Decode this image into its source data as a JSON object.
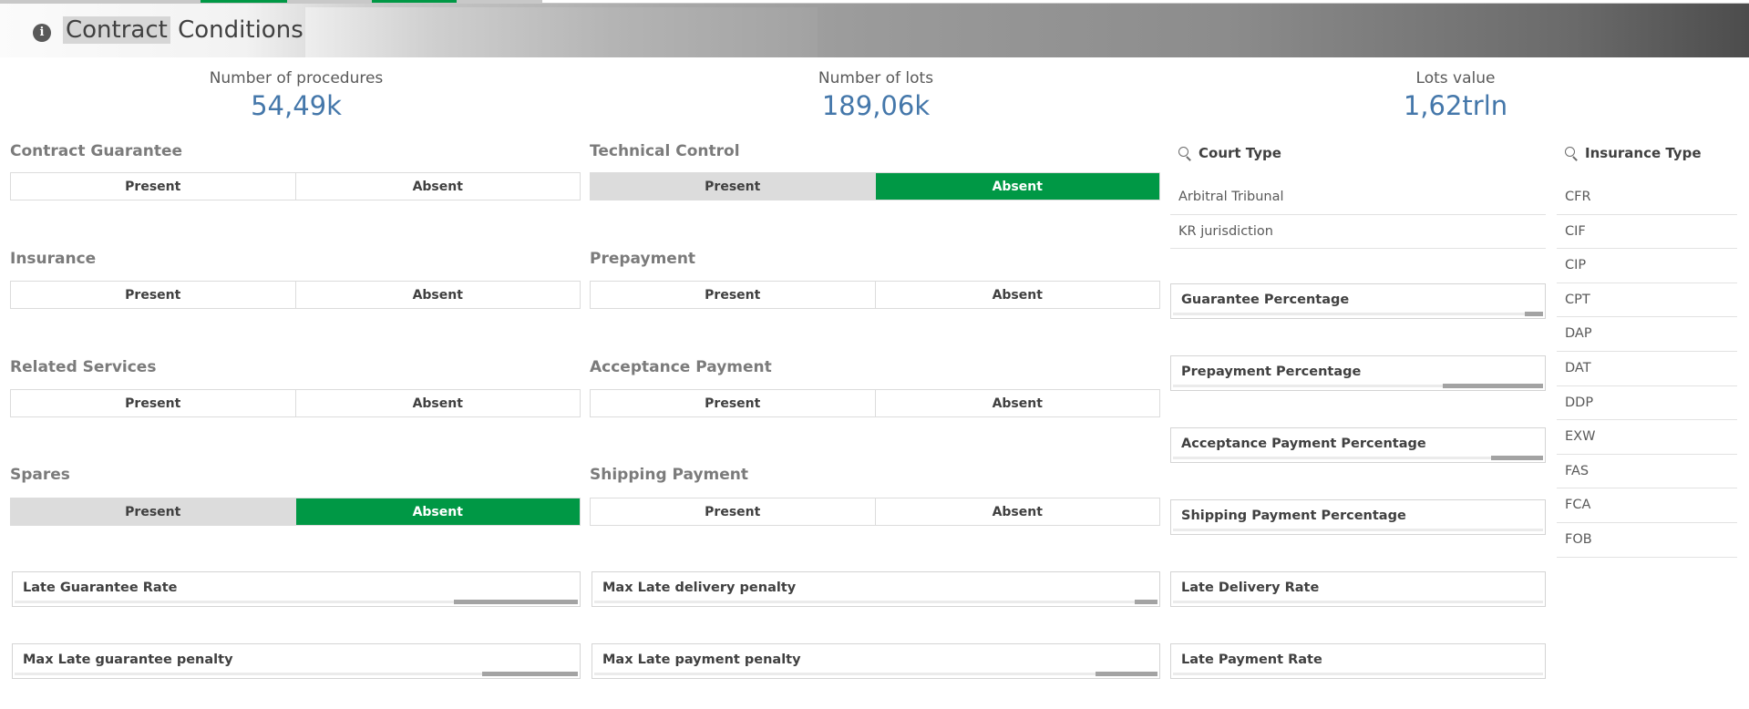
{
  "colors": {
    "selected": "#009845",
    "kpi_value": "#4477aa",
    "alternative": "#dcdcdc"
  },
  "header": {
    "info_icon": "info-icon",
    "title_part1": "Contract",
    "title_part2": "Conditions"
  },
  "kpis": [
    {
      "label": "Number of procedures",
      "value": "54,49k"
    },
    {
      "label": "Number of lots",
      "value": "189,06k"
    },
    {
      "label": "Lots value",
      "value": "1,62trln"
    }
  ],
  "toggles": {
    "contract_guarantee": {
      "title": "Contract Guarantee",
      "present": "Present",
      "absent": "Absent",
      "state": "none"
    },
    "technical_control": {
      "title": "Technical Control",
      "present": "Present",
      "absent": "Absent",
      "state": "absent"
    },
    "insurance": {
      "title": "Insurance",
      "present": "Present",
      "absent": "Absent",
      "state": "none"
    },
    "prepayment": {
      "title": "Prepayment",
      "present": "Present",
      "absent": "Absent",
      "state": "none"
    },
    "related_services": {
      "title": "Related Services",
      "present": "Present",
      "absent": "Absent",
      "state": "none"
    },
    "acceptance_payment": {
      "title": "Acceptance Payment",
      "present": "Present",
      "absent": "Absent",
      "state": "none"
    },
    "spares": {
      "title": "Spares",
      "present": "Present",
      "absent": "Absent",
      "state": "absent"
    },
    "shipping_payment": {
      "title": "Shipping Payment",
      "present": "Present",
      "absent": "Absent",
      "state": "none"
    }
  },
  "court_type": {
    "title": "Court Type",
    "icon": "search-icon",
    "items": [
      "Arbitral Tribunal",
      "KR jurisdiction"
    ]
  },
  "insurance_type": {
    "title": "Insurance Type",
    "icon": "search-icon",
    "items": [
      "CFR",
      "CIF",
      "CIP",
      "CPT",
      "DAP",
      "DAT",
      "DDP",
      "EXW",
      "FAS",
      "FCA",
      "FOB"
    ]
  },
  "sliders": {
    "guarantee_percentage": {
      "label": "Guarantee Percentage",
      "fill_fraction": 0.05
    },
    "prepayment_percentage": {
      "label": "Prepayment Percentage",
      "fill_fraction": 0.27
    },
    "acceptance_payment_percentage": {
      "label": "Acceptance Payment Percentage",
      "fill_fraction": 0.14
    },
    "shipping_payment_percentage": {
      "label": "Shipping Payment Percentage",
      "fill_fraction": 0
    },
    "late_delivery_rate": {
      "label": "Late Delivery Rate",
      "fill_fraction": 0
    },
    "late_payment_rate": {
      "label": "Late Payment Rate",
      "fill_fraction": 0
    },
    "late_guarantee_rate": {
      "label": "Late Guarantee Rate",
      "fill_fraction": 0.22
    },
    "max_late_guarantee_penalty": {
      "label": "Max Late guarantee penalty",
      "fill_fraction": 0.17
    },
    "max_late_delivery_penalty": {
      "label": "Max Late delivery penalty",
      "fill_fraction": 0.04
    },
    "max_late_payment_penalty": {
      "label": "Max Late payment penalty",
      "fill_fraction": 0.11
    }
  }
}
